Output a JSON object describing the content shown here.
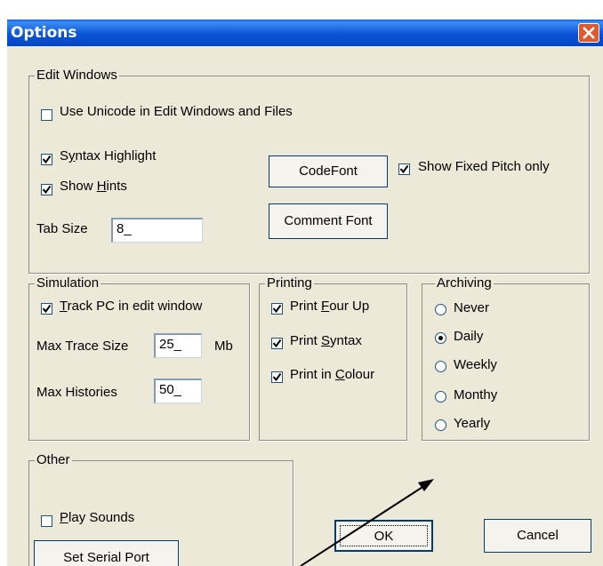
{
  "window": {
    "title": "Options"
  },
  "edit_windows": {
    "legend": "Edit Windows",
    "use_unicode": {
      "label": "Use Unicode in Edit Windows and Files",
      "checked": false
    },
    "syntax_highlight": {
      "pre": "S",
      "mnemonic": "y",
      "post": "ntax Highlight",
      "checked": true
    },
    "show_hints": {
      "pre": "Show ",
      "mnemonic": "H",
      "post": "ints",
      "checked": true
    },
    "tab_size_label": "Tab Size",
    "tab_size_value": "8_",
    "code_font_button": "CodeFont",
    "comment_font_button": "Comment Font",
    "show_fixed_pitch": {
      "label": "Show Fixed Pitch only",
      "checked": true
    }
  },
  "simulation": {
    "legend": "Simulation",
    "track_pc": {
      "pre": "",
      "mnemonic": "T",
      "post": "rack PC in edit window",
      "checked": true
    },
    "max_trace_label": "Max Trace Size",
    "max_trace_value": "25_",
    "max_trace_unit": "Mb",
    "max_histories_label": "Max Histories",
    "max_histories_value": "50_"
  },
  "printing": {
    "legend": "Printing",
    "four_up": {
      "pre": "Print ",
      "mnemonic": "F",
      "post": "our Up",
      "checked": true
    },
    "syntax": {
      "pre": "Print ",
      "mnemonic": "S",
      "post": "yntax",
      "checked": true
    },
    "colour": {
      "pre": "Print in ",
      "mnemonic": "C",
      "post": "olour",
      "checked": true
    }
  },
  "archiving": {
    "legend": "Archiving",
    "options": [
      "Never",
      "Daily",
      "Weekly",
      "Monthy",
      "Yearly"
    ],
    "selected": "Daily"
  },
  "other": {
    "legend": "Other",
    "play_sounds": {
      "pre": "",
      "mnemonic": "P",
      "post": "lay Sounds",
      "checked": false
    },
    "serial_port_button": "Set Serial Port"
  },
  "buttons": {
    "ok": "OK",
    "cancel": "Cancel"
  },
  "colors": {
    "dialog_bg": "#ece9d8",
    "titlebar": "#0a53d8",
    "close": "#e1582e",
    "arrow": "#000000"
  }
}
